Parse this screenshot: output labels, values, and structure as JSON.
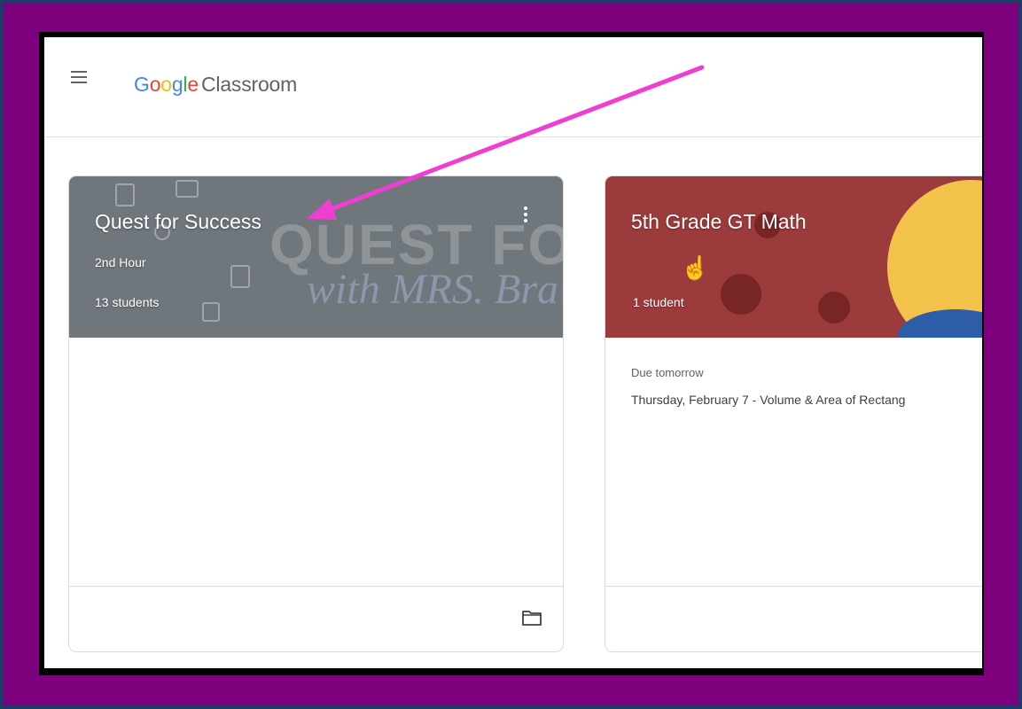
{
  "app": {
    "brand_letters": [
      "G",
      "o",
      "o",
      "g",
      "l",
      "e"
    ],
    "product": "Classroom"
  },
  "cards": [
    {
      "title": "Quest for Success",
      "section": "2nd Hour",
      "students": "13 students",
      "banner_color": "#6f767c",
      "banner_text_1": "QUEST FOR SU",
      "banner_text_2": "with MRS. Bra"
    },
    {
      "title": "5th Grade GT Math",
      "students": "1 student",
      "banner_color": "#9c3b3b",
      "due_label": "Due tomorrow",
      "due_item": "Thursday, February 7 - Volume & Area of Rectang"
    }
  ],
  "colors": {
    "outer_frame": "#7d007d",
    "annotation_arrow": "#ee3fd0"
  }
}
